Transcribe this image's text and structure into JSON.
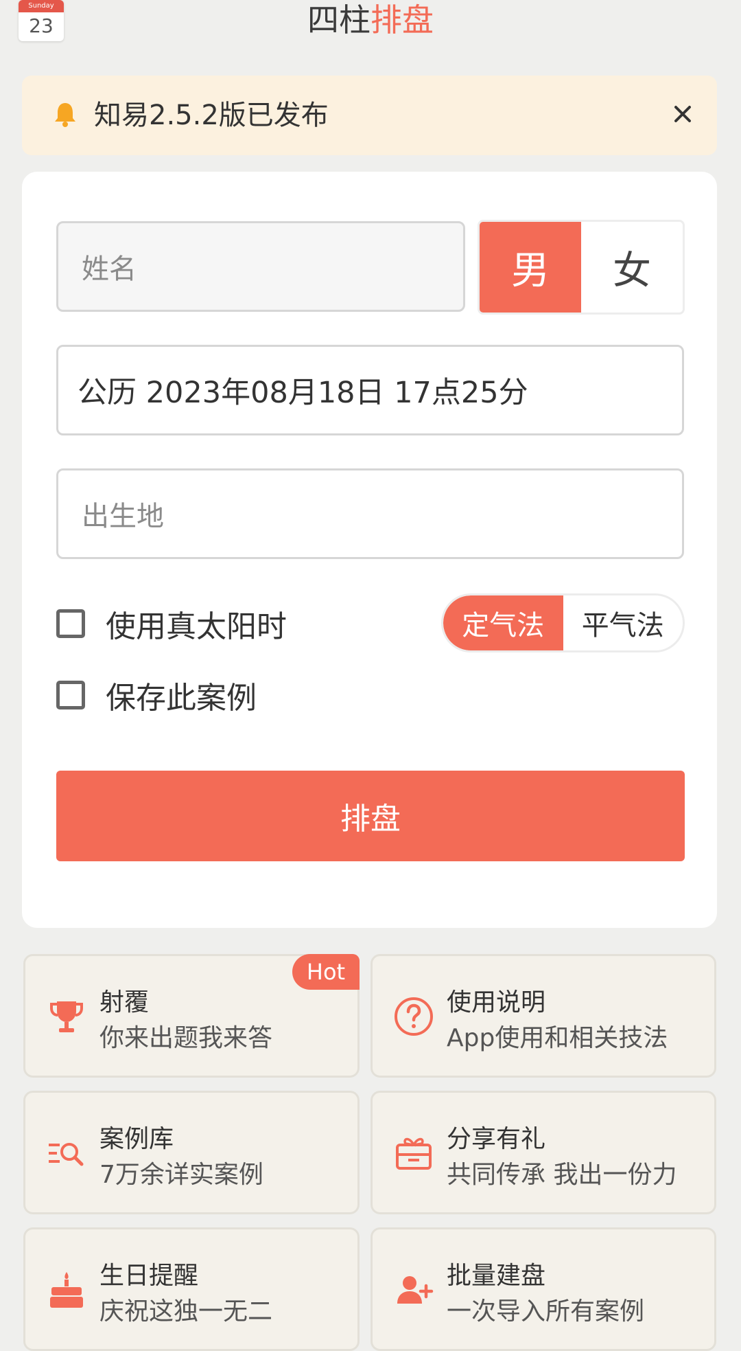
{
  "header": {
    "calendar_weekday": "Sunday",
    "calendar_day": "23",
    "title_main": "四柱",
    "title_accent": "排盘"
  },
  "notice": {
    "text": "知易2.5.2版已发布"
  },
  "form": {
    "name_placeholder": "姓名",
    "gender_male": "男",
    "gender_female": "女",
    "gender_selected": "男",
    "date_value": "公历 2023年08月18日 17点25分",
    "birthplace_placeholder": "出生地",
    "true_solar_label": "使用真太阳时",
    "save_case_label": "保存此案例",
    "qifa_fixed": "定气法",
    "qifa_mean": "平气法",
    "qifa_selected": "定气法",
    "submit_label": "排盘"
  },
  "tiles": [
    {
      "title": "射覆",
      "subtitle": "你来出题我来答",
      "icon": "trophy-icon",
      "badge": "Hot"
    },
    {
      "title": "使用说明",
      "subtitle": "App使用和相关技法",
      "icon": "help-circle-icon"
    },
    {
      "title": "案例库",
      "subtitle": "7万余详实案例",
      "icon": "search-list-icon"
    },
    {
      "title": "分享有礼",
      "subtitle": "共同传承 我出一份力",
      "icon": "gift-icon"
    },
    {
      "title": "生日提醒",
      "subtitle": "庆祝这独一无二",
      "icon": "cake-icon"
    },
    {
      "title": "批量建盘",
      "subtitle": "一次导入所有案例",
      "icon": "add-user-icon"
    }
  ],
  "colors": {
    "accent": "#f36b56",
    "notice_bg": "#fcf1df",
    "tile_bg": "#f4f1ea"
  }
}
